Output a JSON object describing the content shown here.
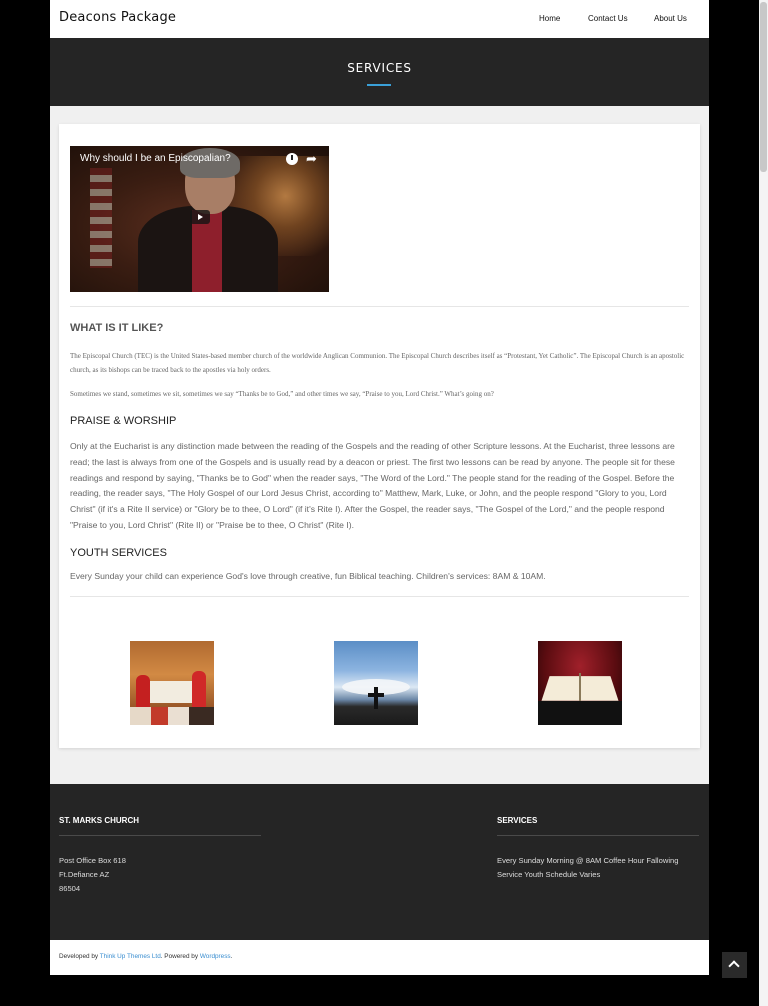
{
  "header": {
    "brand": "Deacons Package",
    "nav": [
      "Home",
      "Contact Us",
      "About Us"
    ]
  },
  "banner": {
    "title": "SERVICES"
  },
  "video": {
    "title": "Why should I be an Episcopalian?"
  },
  "content": {
    "what_heading": "WHAT IS IT LIKE?",
    "what_p1": "The Episcopal Church (TEC) is the United States-based member church of the worldwide Anglican Communion. The Episcopal Church describes itself as “Protestant, Yet Catholic”. The Episcopal Church is an apostolic church, as its bishops can be traced back to the apostles via holy orders.",
    "what_p2": "Sometimes we stand, sometimes we sit, sometimes we say “Thanks be to God,” and other times we say, “Praise to you, Lord Christ.” What’s going on?",
    "praise_heading": "PRAISE & WORSHIP",
    "praise_body": "Only at the Eucharist is any distinction made between the reading of the Gospels and the reading of other Scripture lessons. At the Eucharist, three lessons are read; the last is always from one of the Gospels and is usually read by a deacon or priest. The first two lessons can be read by anyone. The people sit for these readings and respond by saying, \"Thanks be to God\" when the reader says, \"The Word of the Lord.\" The people stand for the reading of the Gospel. Before the reading, the reader says, \"The Holy Gospel of our Lord Jesus Christ, according to\" Matthew, Mark, Luke, or John, and the people respond \"Glory to you, Lord Christ\" (if it's a Rite II service) or \"Glory be to thee, O Lord\" (if it's Rite I). After the Gospel, the reader says, \"The Gospel of the Lord,\" and the people respond \"Praise to you, Lord Christ\" (Rite II) or \"Praise be to thee, O Christ\" (Rite I).",
    "youth_heading": "YOUTH SERVICES",
    "youth_body": "Every Sunday your child can experience God's love through creative, fun Biblical teaching. Children's services: 8AM & 10AM."
  },
  "footer": {
    "col1_heading": "ST. MARKS CHURCH",
    "address_line1": "Post Office Box 618",
    "address_line2": "Ft.Defiance AZ",
    "address_line3": "86504",
    "col2_heading": "SERVICES",
    "services_text": "Every Sunday Morning @ 8AM Coffee Hour Fallowing Service Youth Schedule Varies"
  },
  "copyright": {
    "developed_by": "Developed by",
    "theme_link": "Think Up Themes Ltd",
    "powered_by": ". Powered by",
    "wp_link": "Wordpress",
    "end": "."
  },
  "colors": {
    "accent": "#3aa0d8",
    "dark": "#252525",
    "link": "#3a8ed0"
  }
}
